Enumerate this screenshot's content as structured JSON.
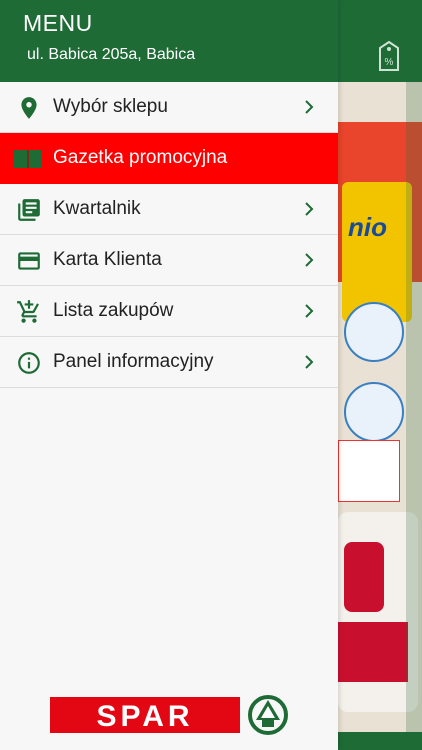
{
  "drawer": {
    "title": "MENU",
    "address": "ul. Babica 205a, Babica",
    "items": [
      {
        "label": "Wybór sklepu",
        "icon": "location-pin-icon",
        "active": false
      },
      {
        "label": "Gazetka promocyjna",
        "icon": "flyer-icon",
        "active": true
      },
      {
        "label": "Kwartalnik",
        "icon": "library-books-icon",
        "active": false
      },
      {
        "label": "Karta Klienta",
        "icon": "credit-card-icon",
        "active": false
      },
      {
        "label": "Lista zakupów",
        "icon": "add-to-cart-icon",
        "active": false
      },
      {
        "label": "Panel informacyjny",
        "icon": "info-icon",
        "active": false
      }
    ]
  },
  "brand": {
    "logo_text": "SPAR",
    "primary_green": "#1e6b36",
    "accent_red": "#ff0000"
  },
  "background": {
    "header_icon": "percent-tag-icon"
  }
}
